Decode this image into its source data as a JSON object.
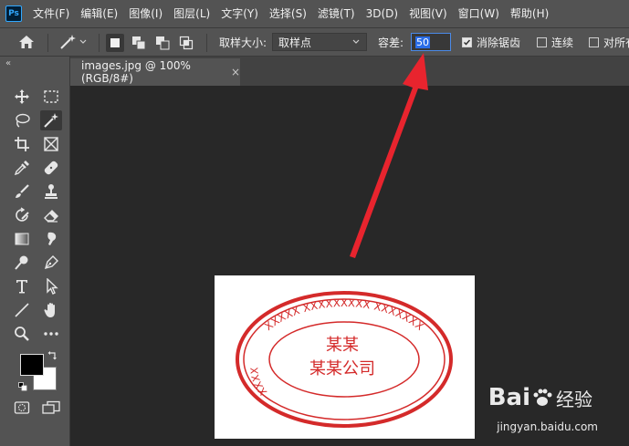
{
  "menubar": {
    "logo": "Ps",
    "items": [
      "文件(F)",
      "编辑(E)",
      "图像(I)",
      "图层(L)",
      "文字(Y)",
      "选择(S)",
      "滤镜(T)",
      "3D(D)",
      "视图(V)",
      "窗口(W)",
      "帮助(H)"
    ]
  },
  "options": {
    "sample_size_label": "取样大小:",
    "sample_size_value": "取样点",
    "tolerance_label": "容差:",
    "tolerance_value": "50",
    "antialias_label": "消除锯齿",
    "antialias_checked": true,
    "contiguous_label": "连续",
    "contiguous_checked": false,
    "all_layers_label": "对所有",
    "all_layers_checked": false
  },
  "document": {
    "tab_title": "images.jpg @ 100%(RGB/8#)",
    "close": "×",
    "stamp": {
      "arc_text_top": "XXXXX XXXXXXXXX XXXXXXX",
      "arc_text_left": "XXXX",
      "line1": "某某",
      "line2": "某某公司",
      "color": "#d42a2a"
    }
  },
  "watermark": {
    "logo": "Bai",
    "text": "经验",
    "url": "jingyan.baidu.com"
  },
  "colors": {
    "arrow": "#e8242e",
    "foreground": "#000000",
    "background": "#ffffff"
  }
}
